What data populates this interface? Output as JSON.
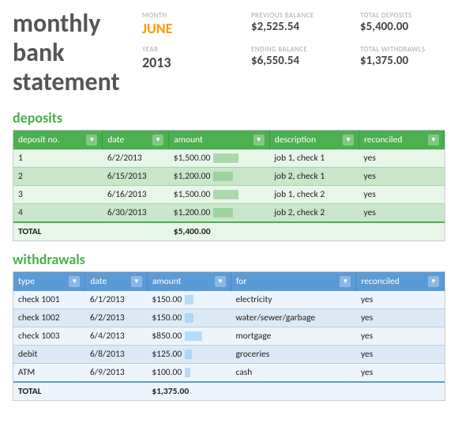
{
  "header": {
    "title_line1": "monthly",
    "title_line2": "bank",
    "title_line3": "statement",
    "meta": {
      "month_label": "MONTH",
      "month_value": "JUNE",
      "prev_balance_label": "PREVIOUS BALANCE",
      "prev_balance_value": "$2,525.54",
      "total_deposits_label": "TOTAL DEPOSITS",
      "total_deposits_value": "$5,400.00",
      "year_label": "YEAR",
      "year_value": "2013",
      "ending_balance_label": "ENDING BALANCE",
      "ending_balance_value": "$6,550.54",
      "total_withdrawls_label": "TOTAL WITHDRAWLS",
      "total_withdrawls_value": "$1,375.00"
    }
  },
  "deposits": {
    "section_title": "deposits",
    "columns": [
      "deposit no.",
      "date",
      "amount",
      "description",
      "reconciled"
    ],
    "rows": [
      {
        "no": "1",
        "date": "6/2/2013",
        "amount": "$1,500.00",
        "description": "job 1, check 1",
        "reconciled": "yes",
        "bar_pct": 78
      },
      {
        "no": "2",
        "date": "6/15/2013",
        "amount": "$1,200.00",
        "description": "job 2, check 1",
        "reconciled": "yes",
        "bar_pct": 62
      },
      {
        "no": "3",
        "date": "6/16/2013",
        "amount": "$1,500.00",
        "description": "job 1, check 2",
        "reconciled": "yes",
        "bar_pct": 78
      },
      {
        "no": "4",
        "date": "6/30/2013",
        "amount": "$1,200.00",
        "description": "job 2, check 2",
        "reconciled": "yes",
        "bar_pct": 62
      }
    ],
    "total_label": "TOTAL",
    "total_amount": "$5,400.00"
  },
  "withdrawals": {
    "section_title": "withdrawals",
    "columns": [
      "type",
      "date",
      "amount",
      "for",
      "reconciled"
    ],
    "rows": [
      {
        "type": "check 1001",
        "date": "6/1/2013",
        "amount": "$150.00",
        "for": "electricity",
        "reconciled": "yes",
        "bar_pct": 30
      },
      {
        "type": "check 1002",
        "date": "6/2/2013",
        "amount": "$150.00",
        "for": "water/sewer/garbage",
        "reconciled": "yes",
        "bar_pct": 30
      },
      {
        "type": "check 1003",
        "date": "6/4/2013",
        "amount": "$850.00",
        "for": "mortgage",
        "reconciled": "yes",
        "bar_pct": 62
      },
      {
        "type": "debit",
        "date": "6/8/2013",
        "amount": "$125.00",
        "for": "groceries",
        "reconciled": "yes",
        "bar_pct": 25
      },
      {
        "type": "ATM",
        "date": "6/9/2013",
        "amount": "$100.00",
        "for": "cash",
        "reconciled": "yes",
        "bar_pct": 20
      }
    ],
    "total_label": "TOTAL",
    "total_amount": "$1,375.00"
  }
}
